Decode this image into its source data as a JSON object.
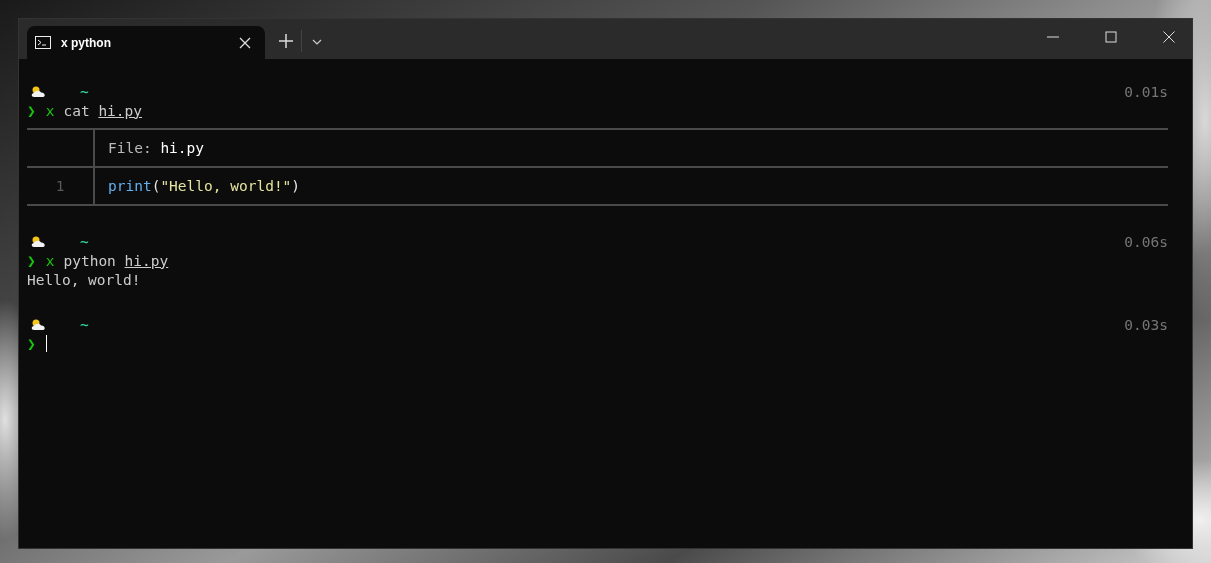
{
  "tabs": [
    {
      "title": "x python",
      "selected": true
    }
  ],
  "blocks": [
    {
      "kind": "command",
      "dir": "~",
      "time": "0.01s",
      "prompt": "❯",
      "shell": "x",
      "command": "cat",
      "argument": "hi.py",
      "file_view": {
        "header_label": "File:",
        "file_name": "hi.py",
        "lines": [
          {
            "number": "1",
            "code": [
              {
                "text": "print",
                "kind": "function"
              },
              {
                "text": "(",
                "kind": "punct"
              },
              {
                "text": "\"Hello, world!\"",
                "kind": "string"
              },
              {
                "text": ")",
                "kind": "punct"
              }
            ]
          }
        ]
      }
    },
    {
      "kind": "command",
      "dir": "~",
      "time": "0.06s",
      "prompt": "❯",
      "shell": "x",
      "command": "python",
      "argument": "hi.py",
      "output": "Hello, world!"
    },
    {
      "kind": "input",
      "dir": "~",
      "time": "0.03s",
      "prompt": "❯"
    }
  ]
}
